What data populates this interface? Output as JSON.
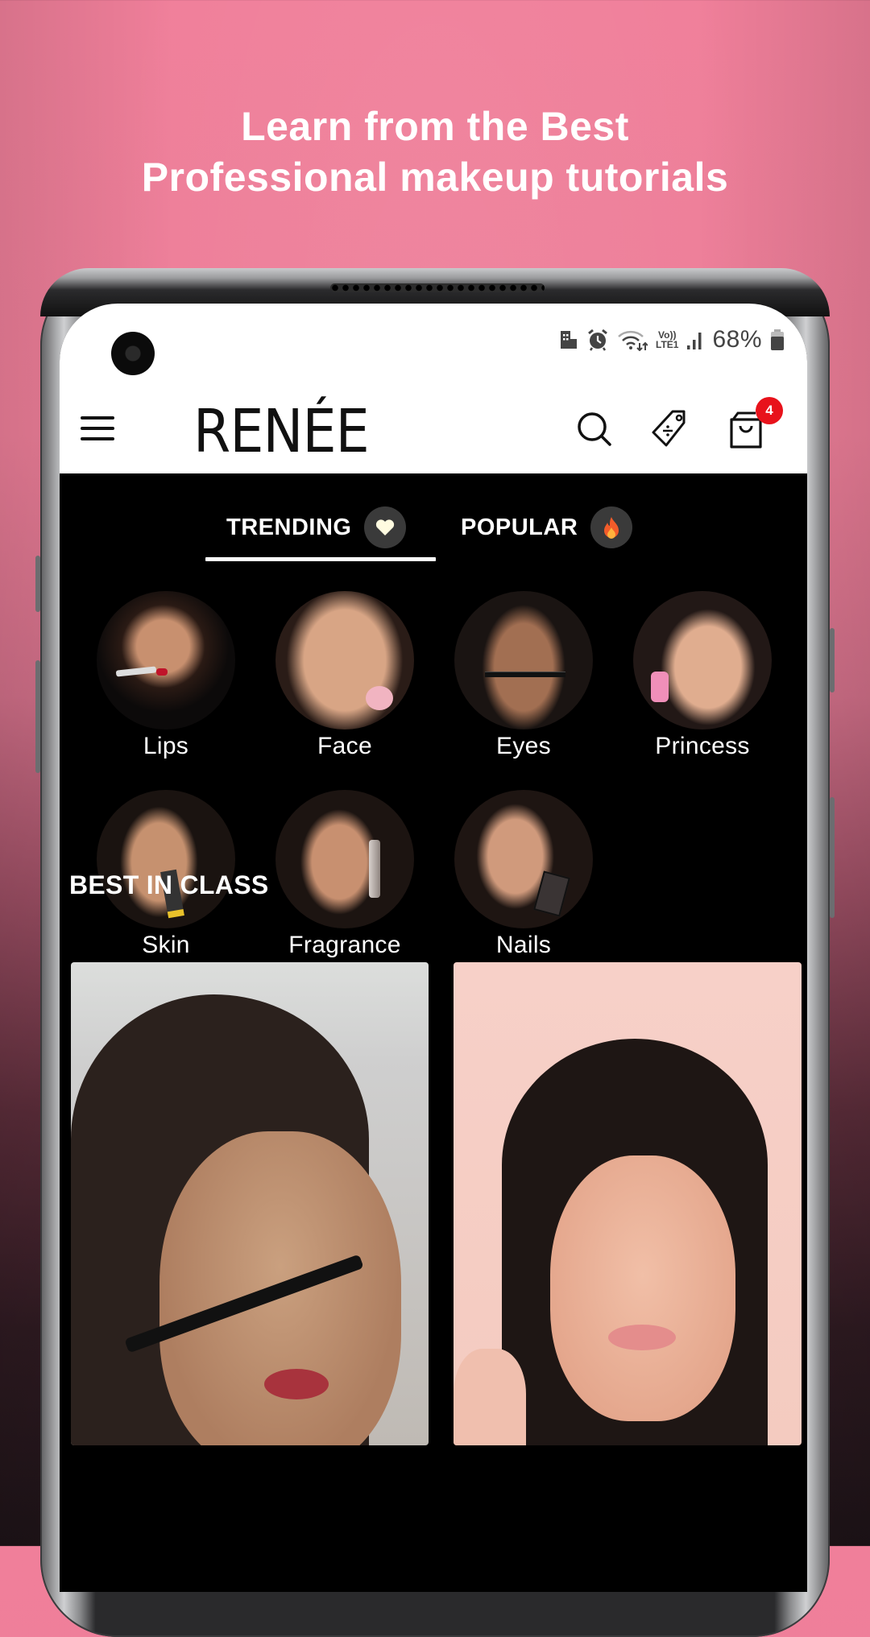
{
  "promo": {
    "headline_line1": "Learn from the Best",
    "headline_line2": "Professional makeup tutorials"
  },
  "status_bar": {
    "icons": [
      "work-profile-icon",
      "alarm-icon",
      "wifi-icon",
      "volte-lte-icon",
      "signal-icon",
      "battery-icon"
    ],
    "volte_label": "Vo))",
    "lte_label": "LTE1",
    "battery_percent": "68%"
  },
  "app_bar": {
    "menu_icon": "hamburger-menu-icon",
    "logo_text": "RENÉE",
    "actions": [
      {
        "icon": "search-icon",
        "label": "Search"
      },
      {
        "icon": "offers-tag-icon",
        "label": "Offers"
      },
      {
        "icon": "shopping-bag-icon",
        "label": "Cart"
      }
    ],
    "cart_count": "4"
  },
  "tabs": [
    {
      "label": "TRENDING",
      "icon": "heart-icon",
      "active": true
    },
    {
      "label": "POPULAR",
      "icon": "fire-icon",
      "active": false
    }
  ],
  "categories": [
    {
      "label": "Lips"
    },
    {
      "label": "Face"
    },
    {
      "label": "Eyes"
    },
    {
      "label": "Princess"
    },
    {
      "label": "Skin"
    },
    {
      "label": "Fragrance"
    },
    {
      "label": "Nails"
    }
  ],
  "best_in_class": {
    "title": "BEST IN CLASS",
    "cards": [
      {
        "thumbnail": "eyeliner-tutorial-video-thumbnail"
      },
      {
        "thumbnail": "eye-makeup-tutorial-video-thumbnail"
      }
    ]
  },
  "colors": {
    "promo_background": "#ec7e98",
    "badge_red": "#e8121b",
    "app_background": "#000000"
  }
}
